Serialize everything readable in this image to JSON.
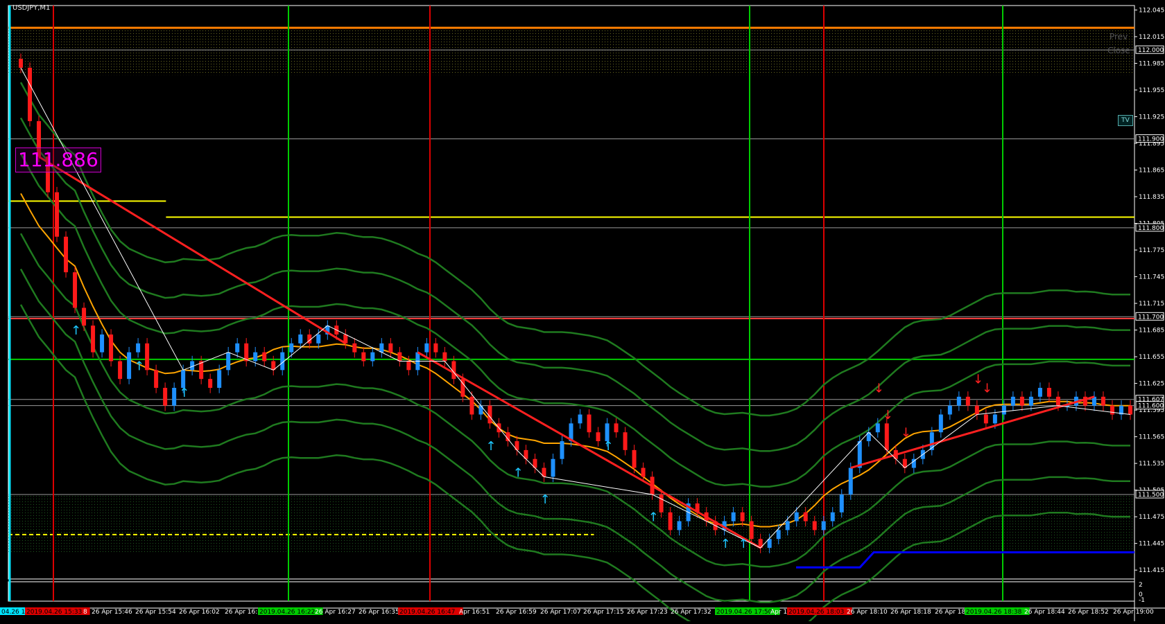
{
  "symbol_label": "USDJPY,M1",
  "price_badge": "111.886",
  "tv_badge": "TV",
  "ghost_labels": [
    "Prev",
    "Close"
  ],
  "colors": {
    "background": "#000000",
    "bull": "#1e90ff",
    "bear": "#ff1a1a",
    "grid": "#ffffff",
    "green_vline": "#00cc00",
    "red_vline": "#dd0000",
    "orange_line": "#ff8000",
    "yellow_line": "#ffff00",
    "ma_orange": "#ffa500",
    "band_green": "#1f7a1f",
    "magenta": "#ff00ff",
    "blue_line": "#0000ff"
  },
  "chart_data": {
    "type": "candlestick",
    "symbol": "USDJPY",
    "timeframe": "M1",
    "ylim": [
      111.405,
      112.05
    ],
    "price_ticks": [
      "112.045",
      "112.015",
      "111.985",
      "111.955",
      "111.925",
      "111.895",
      "111.865",
      "111.835",
      "111.805",
      "111.775",
      "111.745",
      "111.715",
      "111.685",
      "111.655",
      "111.625",
      "111.595",
      "111.565",
      "111.535",
      "111.505",
      "111.475",
      "111.445",
      "111.415"
    ],
    "price_tags": [
      {
        "label": "112.000",
        "value": 112.0,
        "color": "#ffffff"
      },
      {
        "label": "111.900",
        "value": 111.9,
        "color": "#ffffff"
      },
      {
        "label": "111.800",
        "value": 111.8,
        "color": "#ffffff"
      },
      {
        "label": "111.700",
        "value": 111.7,
        "color": "#ffffff"
      },
      {
        "label": "111.607",
        "value": 111.607,
        "color": "#ffffff"
      },
      {
        "label": "111.600",
        "value": 111.6,
        "color": "#ffffff"
      },
      {
        "label": "111.500",
        "value": 111.5,
        "color": "#ffffff"
      }
    ],
    "time_labels": [
      "04.26 15",
      "2019.04.26 15:33",
      "8",
      "26 Apr 15:46",
      "26 Apr 15:54",
      "26 Apr 16:02",
      "26 Apr 16:1",
      "2019.04.26 16:22",
      "26 Apr 16:27",
      "26 Apr 16:35",
      "2019.04.26 16:47",
      "Apr 16:51",
      "26 Apr 16:59",
      "26 Apr 17:07",
      "26 Apr 17:15",
      "26 Apr 17:23",
      "26 Apr 17:32",
      "2019.04.26 17:50",
      "Apr 17",
      "2019.04.26 18:03",
      "26 Apr 18:10",
      "26 Apr 18:18",
      "26 Apr 18",
      "2019.04.26 18:38",
      "26 Apr 18:44",
      "26 Apr 18:52",
      "26 Apr 19:00"
    ],
    "indicator_ticks": [
      "2",
      "0",
      "-1"
    ],
    "horizontal_lines": [
      {
        "value": 112.025,
        "color": "#ff8000",
        "style": "solid"
      },
      {
        "value": 111.83,
        "color": "#ffff00",
        "style": "solid",
        "x_end_frac": 0.14
      },
      {
        "value": 111.812,
        "color": "#ffff00",
        "style": "solid",
        "x_start_frac": 0.14
      },
      {
        "value": 111.652,
        "color": "#00cc00",
        "style": "solid"
      },
      {
        "value": 111.698,
        "color": "#ff4040",
        "style": "solid"
      },
      {
        "value": 111.455,
        "color": "#ffff00",
        "style": "dashed",
        "x_end_frac": 0.52
      }
    ],
    "candle_path": [
      111.98,
      111.92,
      111.88,
      111.84,
      111.79,
      111.75,
      111.71,
      111.69,
      111.66,
      111.68,
      111.65,
      111.63,
      111.66,
      111.67,
      111.64,
      111.62,
      111.6,
      111.62,
      111.64,
      111.65,
      111.63,
      111.62,
      111.64,
      111.66,
      111.67,
      111.65,
      111.66,
      111.65,
      111.64,
      111.66,
      111.67,
      111.68,
      111.67,
      111.68,
      111.69,
      111.68,
      111.67,
      111.66,
      111.65,
      111.66,
      111.67,
      111.66,
      111.65,
      111.64,
      111.66,
      111.67,
      111.66,
      111.65,
      111.63,
      111.61,
      111.59,
      111.6,
      111.58,
      111.57,
      111.56,
      111.55,
      111.54,
      111.53,
      111.52,
      111.54,
      111.56,
      111.58,
      111.59,
      111.57,
      111.56,
      111.58,
      111.57,
      111.55,
      111.53,
      111.52,
      111.5,
      111.48,
      111.46,
      111.47,
      111.49,
      111.48,
      111.47,
      111.46,
      111.47,
      111.48,
      111.47,
      111.45,
      111.44,
      111.45,
      111.46,
      111.47,
      111.48,
      111.47,
      111.46,
      111.47,
      111.48,
      111.5,
      111.53,
      111.56,
      111.57,
      111.58,
      111.55,
      111.54,
      111.53,
      111.54,
      111.55,
      111.57,
      111.59,
      111.6,
      111.61,
      111.6,
      111.59,
      111.58,
      111.59,
      111.6,
      111.61,
      111.6,
      111.61,
      111.62,
      111.61,
      111.6,
      111.6,
      111.61,
      111.6,
      111.61,
      111.6,
      111.59,
      111.6,
      111.59
    ]
  }
}
